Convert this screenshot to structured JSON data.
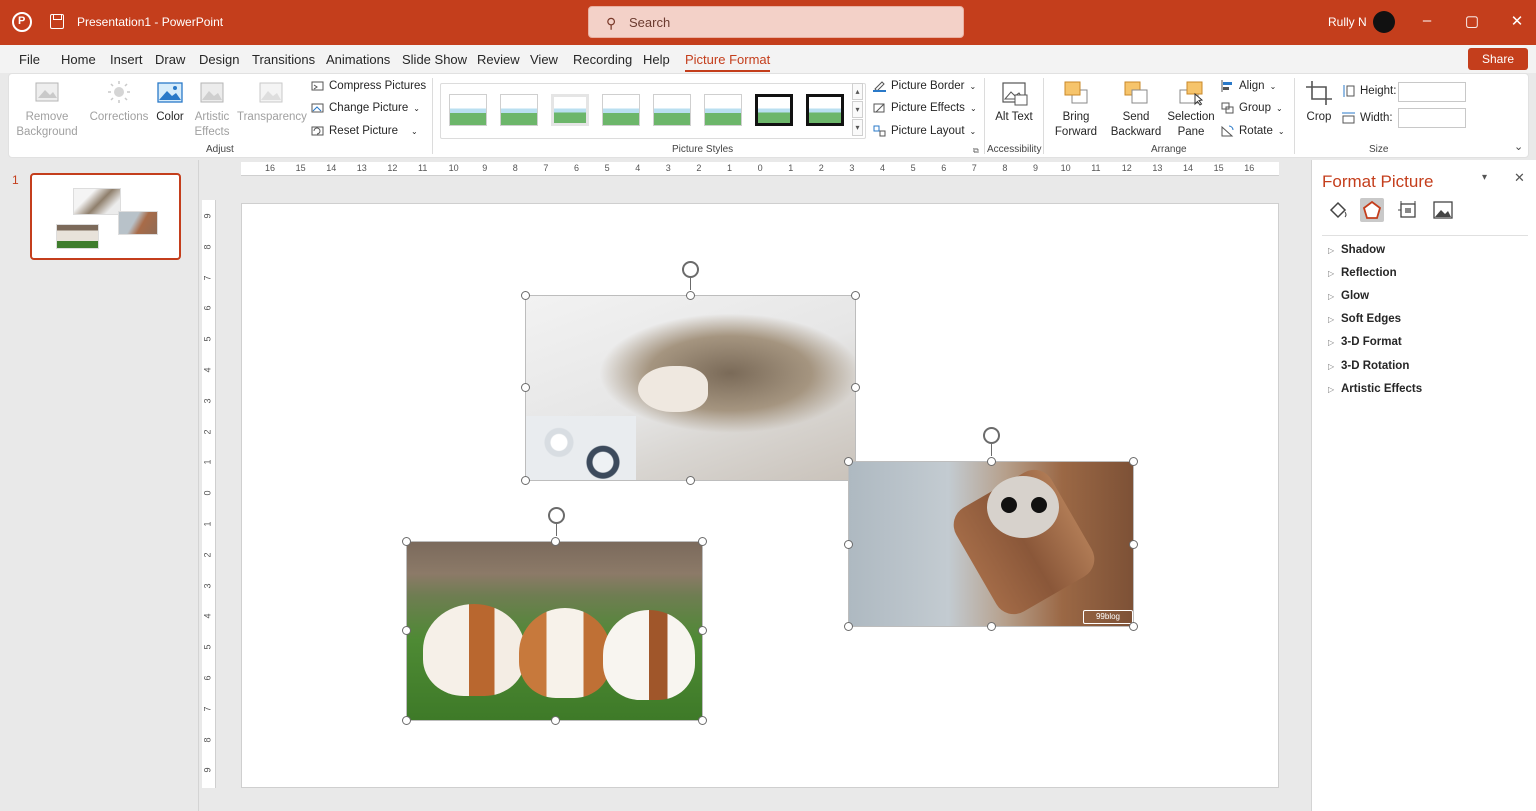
{
  "titlebar": {
    "doc_title": "Presentation1  -  PowerPoint",
    "search_placeholder": "Search",
    "user_name": "Rully N",
    "minimize": "–",
    "restore": "▢",
    "close": "✕"
  },
  "menu": {
    "tabs": [
      "File",
      "Home",
      "Insert",
      "Draw",
      "Design",
      "Transitions",
      "Animations",
      "Slide Show",
      "Review",
      "View",
      "Recording",
      "Help",
      "Picture Format"
    ],
    "active": "Picture Format",
    "share_label": "Share"
  },
  "ribbon": {
    "remove_background": "Remove Background",
    "corrections": "Corrections",
    "color": "Color",
    "artistic_effects": "Artistic Effects",
    "transparency": "Transparency",
    "compress_pictures": "Compress Pictures",
    "change_picture": "Change Picture",
    "reset_picture": "Reset Picture",
    "adjust_label": "Adjust",
    "picture_styles_label": "Picture Styles",
    "picture_border": "Picture Border",
    "picture_effects": "Picture Effects",
    "picture_layout": "Picture Layout",
    "alt_text": "Alt Text",
    "accessibility_label": "Accessibility",
    "bring_forward": "Bring Forward",
    "send_backward": "Send Backward",
    "selection_pane": "Selection Pane",
    "align": "Align",
    "group": "Group",
    "rotate": "Rotate",
    "arrange_label": "Arrange",
    "crop": "Crop",
    "height_label": "Height:",
    "width_label": "Width:",
    "size_label": "Size"
  },
  "slides_panel": {
    "slide_number": "1"
  },
  "ruler": {
    "h_labels": [
      "16",
      "15",
      "14",
      "13",
      "12",
      "11",
      "10",
      "9",
      "8",
      "7",
      "6",
      "5",
      "4",
      "3",
      "2",
      "1",
      "0",
      "1",
      "2",
      "3",
      "4",
      "5",
      "6",
      "7",
      "8",
      "9",
      "10",
      "11",
      "12",
      "13",
      "14",
      "15",
      "16"
    ],
    "v_labels": [
      "9",
      "8",
      "7",
      "6",
      "5",
      "4",
      "3",
      "2",
      "1",
      "0",
      "1",
      "2",
      "3",
      "4",
      "5",
      "6",
      "7",
      "8",
      "9"
    ]
  },
  "format_pane": {
    "title": "Format Picture",
    "sections": [
      "Shadow",
      "Reflection",
      "Glow",
      "Soft Edges",
      "3-D Format",
      "3-D Rotation",
      "Artistic Effects"
    ]
  },
  "pictures": {
    "watermark": "99blog"
  }
}
